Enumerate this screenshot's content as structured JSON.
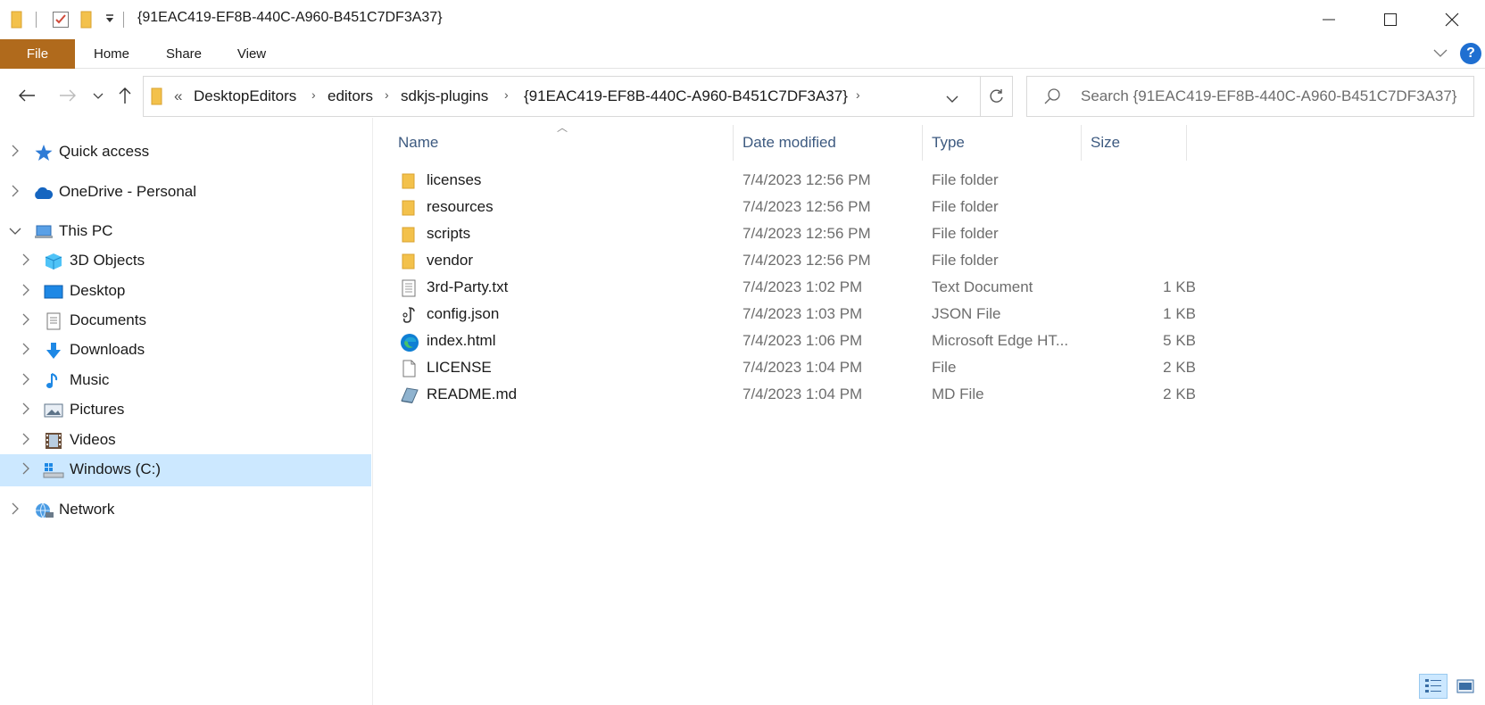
{
  "window": {
    "title": "{91EAC419-EF8B-440C-A960-B451C7DF3A37}",
    "minimize_glyph": "—",
    "maximize_glyph": "☐",
    "close_glyph": "✕"
  },
  "ribbon": {
    "tabs": [
      {
        "label": "File",
        "active": true
      },
      {
        "label": "Home"
      },
      {
        "label": "Share"
      },
      {
        "label": "View"
      }
    ],
    "expand_glyph": "⌄",
    "help_glyph": "?"
  },
  "address": {
    "overflow": "«",
    "crumbs": [
      "DesktopEditors",
      "editors",
      "sdkjs-plugins",
      "{91EAC419-EF8B-440C-A960-B451C7DF3A37}"
    ],
    "separator": "›",
    "dropdown_glyph": "⌄",
    "refresh_glyph": "↻"
  },
  "search": {
    "placeholder": "Search {91EAC419-EF8B-440C-A960-B451C7DF3A37}"
  },
  "nav_buttons": {
    "back": "←",
    "forward": "→",
    "recent": "⌄",
    "up": "↑"
  },
  "navpane": {
    "items": [
      {
        "label": "Quick access",
        "icon": "star-icon",
        "expanded": false,
        "level": 0
      },
      {
        "label": "OneDrive - Personal",
        "icon": "cloud-icon",
        "expanded": false,
        "level": 0
      },
      {
        "label": "This PC",
        "icon": "computer-icon",
        "expanded": true,
        "level": 0
      },
      {
        "label": "3D Objects",
        "icon": "cube-icon",
        "expanded": false,
        "level": 1
      },
      {
        "label": "Desktop",
        "icon": "desktop-icon",
        "expanded": false,
        "level": 1
      },
      {
        "label": "Documents",
        "icon": "document-icon",
        "expanded": false,
        "level": 1
      },
      {
        "label": "Downloads",
        "icon": "download-icon",
        "expanded": false,
        "level": 1
      },
      {
        "label": "Music",
        "icon": "music-icon",
        "expanded": false,
        "level": 1
      },
      {
        "label": "Pictures",
        "icon": "pictures-icon",
        "expanded": false,
        "level": 1
      },
      {
        "label": "Videos",
        "icon": "videos-icon",
        "expanded": false,
        "level": 1
      },
      {
        "label": "Windows (C:)",
        "icon": "drive-icon",
        "expanded": false,
        "level": 1,
        "selected": true
      },
      {
        "label": "Network",
        "icon": "network-icon",
        "expanded": false,
        "level": 0
      }
    ]
  },
  "columns": {
    "name": "Name",
    "date": "Date modified",
    "type": "Type",
    "size": "Size"
  },
  "files": [
    {
      "name": "licenses",
      "date": "7/4/2023 12:56 PM",
      "type": "File folder",
      "size": "",
      "icon": "folder-icon"
    },
    {
      "name": "resources",
      "date": "7/4/2023 12:56 PM",
      "type": "File folder",
      "size": "",
      "icon": "folder-icon"
    },
    {
      "name": "scripts",
      "date": "7/4/2023 12:56 PM",
      "type": "File folder",
      "size": "",
      "icon": "folder-icon"
    },
    {
      "name": "vendor",
      "date": "7/4/2023 12:56 PM",
      "type": "File folder",
      "size": "",
      "icon": "folder-icon"
    },
    {
      "name": "3rd-Party.txt",
      "date": "7/4/2023 1:02 PM",
      "type": "Text Document",
      "size": "1 KB",
      "icon": "text-file-icon"
    },
    {
      "name": "config.json",
      "date": "7/4/2023 1:03 PM",
      "type": "JSON File",
      "size": "1 KB",
      "icon": "json-file-icon"
    },
    {
      "name": "index.html",
      "date": "7/4/2023 1:06 PM",
      "type": "Microsoft Edge HT...",
      "size": "5 KB",
      "icon": "edge-icon"
    },
    {
      "name": "LICENSE",
      "date": "7/4/2023 1:04 PM",
      "type": "File",
      "size": "2 KB",
      "icon": "blank-file-icon"
    },
    {
      "name": "README.md",
      "date": "7/4/2023 1:04 PM",
      "type": "MD File",
      "size": "2 KB",
      "icon": "md-file-icon"
    }
  ],
  "colors": {
    "file_tab": "#b06a1c",
    "selected": "#cce8ff",
    "folder": "#f3c14b",
    "header_text": "#3d5a80"
  }
}
